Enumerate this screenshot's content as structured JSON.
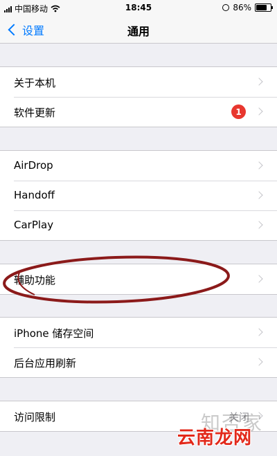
{
  "status_bar": {
    "carrier": "中国移动",
    "time": "18:45",
    "battery_percent": "86%",
    "battery_level": 0.86
  },
  "nav": {
    "back_label": "设置",
    "title": "通用"
  },
  "groups": [
    {
      "rows": [
        {
          "label": "关于本机"
        },
        {
          "label": "软件更新",
          "badge": "1"
        }
      ]
    },
    {
      "rows": [
        {
          "label": "AirDrop"
        },
        {
          "label": "Handoff"
        },
        {
          "label": "CarPlay"
        }
      ]
    },
    {
      "rows": [
        {
          "label": "辅助功能"
        }
      ]
    },
    {
      "rows": [
        {
          "label": "iPhone 储存空间"
        },
        {
          "label": "后台应用刷新"
        }
      ]
    },
    {
      "rows": [
        {
          "label": "访问限制",
          "value": "关闭"
        }
      ]
    }
  ],
  "watermark": {
    "top": "知否家",
    "bottom": "云南龙网"
  },
  "colors": {
    "accent": "#007aff",
    "badge": "#e8372f",
    "highlight_ellipse": "#8b1a1a"
  },
  "icons": [
    "signal-icon",
    "wifi-icon",
    "orientation-lock-icon",
    "battery-icon",
    "chevron-left-icon",
    "chevron-right-icon"
  ]
}
